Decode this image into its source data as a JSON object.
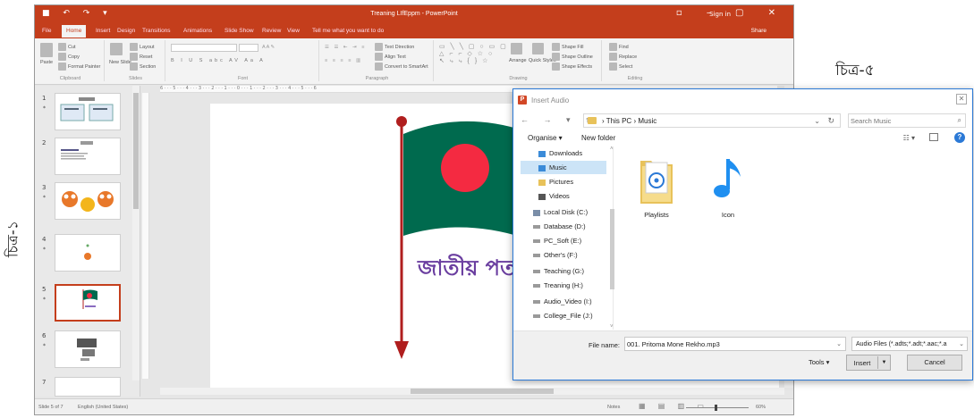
{
  "figure_labels": {
    "left": "চিত্র-১",
    "right": "চিত্র-৫"
  },
  "powerpoint": {
    "title": "Treaning LIfEppm - PowerPoint",
    "sign_in": "Sign in",
    "tabs": [
      "File",
      "Home",
      "Insert",
      "Design",
      "Transitions",
      "Animations",
      "Slide Show",
      "Review",
      "View",
      "Tell me what you want to do"
    ],
    "active_tab": "Home",
    "share": "Share",
    "ribbon": {
      "clipboard": {
        "label": "Clipboard",
        "paste": "Paste",
        "cut": "Cut",
        "copy": "Copy",
        "format_painter": "Format Painter"
      },
      "slides": {
        "label": "Slides",
        "new_slide": "New Slide",
        "layout": "Layout",
        "reset": "Reset",
        "section": "Section"
      },
      "font": {
        "label": "Font",
        "font_name": "",
        "font_size": ""
      },
      "paragraph": {
        "label": "Paragraph",
        "text_direction": "Text Direction",
        "align_text": "Align Text",
        "convert_smartart": "Convert to SmartArt"
      },
      "drawing": {
        "label": "Drawing",
        "arrange": "Arrange",
        "quick_styles": "Quick Styles",
        "shape_fill": "Shape Fill",
        "shape_outline": "Shape Outline",
        "shape_effects": "Shape Effects"
      },
      "editing": {
        "label": "Editing",
        "find": "Find",
        "replace": "Replace",
        "select": "Select"
      }
    },
    "thumbnails": [
      {
        "num": "1",
        "star": "*"
      },
      {
        "num": "2",
        "star": ""
      },
      {
        "num": "3",
        "star": "*"
      },
      {
        "num": "4",
        "star": "*"
      },
      {
        "num": "5",
        "star": "*"
      },
      {
        "num": "6",
        "star": "*"
      },
      {
        "num": "7",
        "star": ""
      }
    ],
    "selected_slide": 5,
    "slide_text": "জাতীয় পত",
    "ruler_ticks": "6 · · · 5 · · · 4 · · · 3 · · · 2 · · · 1 · · · 0 · · · 1 · · · 2 · · · 3 · · · 4 · · · 5 · · · 6",
    "status": {
      "slide_of": "Slide 5 of 7",
      "language": "English (United States)",
      "notes": "Notes",
      "zoom": "60%"
    },
    "colors": {
      "accent": "#c43e1c",
      "flag_green": "#006a4e",
      "flag_red": "#f42a41",
      "pole": "#b01e1e",
      "text_purple": "#6b3fa0"
    }
  },
  "dialog": {
    "title": "Insert Audio",
    "breadcrumb": [
      "This PC",
      "Music"
    ],
    "search_placeholder": "Search Music",
    "organise": "Organise ▾",
    "new_folder": "New folder",
    "nav_items": [
      {
        "label": "Downloads",
        "icon": "download-folder-icon",
        "color": "#3b8bd8"
      },
      {
        "label": "Music",
        "icon": "music-folder-icon",
        "color": "#3b8bd8"
      },
      {
        "label": "Pictures",
        "icon": "pictures-folder-icon",
        "color": "#e8c25a"
      },
      {
        "label": "Videos",
        "icon": "videos-folder-icon",
        "color": "#555555"
      },
      {
        "label": "Local Disk (C:)",
        "icon": "disk-icon",
        "color": "#7a8ea8"
      },
      {
        "label": "Database (D:)",
        "icon": "drive-icon",
        "color": "#9a9a9a"
      },
      {
        "label": "PC_Soft (E:)",
        "icon": "drive-icon",
        "color": "#9a9a9a"
      },
      {
        "label": "Other's (F:)",
        "icon": "drive-icon",
        "color": "#9a9a9a"
      },
      {
        "label": "Teaching (G:)",
        "icon": "drive-icon",
        "color": "#9a9a9a"
      },
      {
        "label": "Treaning (H:)",
        "icon": "drive-icon",
        "color": "#9a9a9a"
      },
      {
        "label": "Audio_Video (I:)",
        "icon": "drive-icon",
        "color": "#9a9a9a"
      },
      {
        "label": "College_File (J:)",
        "icon": "drive-icon",
        "color": "#9a9a9a"
      }
    ],
    "selected_nav": 1,
    "files": [
      {
        "label": "Playlists",
        "icon": "playlist-folder-icon"
      },
      {
        "label": "Icon",
        "icon": "music-note-icon"
      }
    ],
    "file_name_label": "File name:",
    "file_name_value": "001. Pritoma Mone Rekho.mp3",
    "filter": "Audio Files (*.adts;*.adt;*.aac;*.a",
    "tools": "Tools",
    "insert": "Insert",
    "cancel": "Cancel"
  }
}
